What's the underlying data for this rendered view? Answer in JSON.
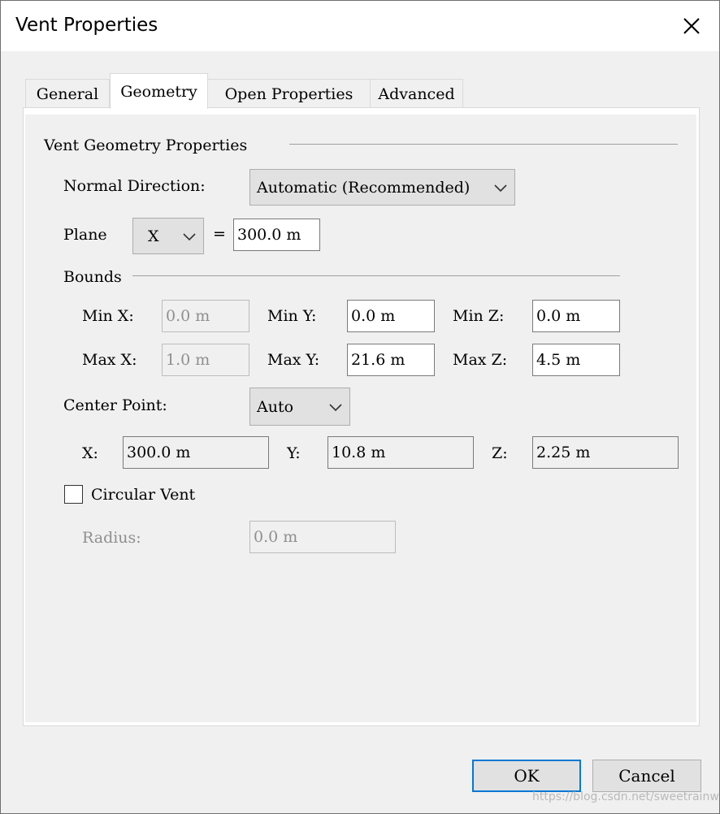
{
  "window": {
    "title": "Vent Properties",
    "close_icon": "close-icon"
  },
  "tabs": [
    {
      "label": "General",
      "active": false
    },
    {
      "label": "Geometry",
      "active": true
    },
    {
      "label": "Open Properties",
      "active": false
    },
    {
      "label": "Advanced",
      "active": false
    }
  ],
  "geometry": {
    "group_label": "Vent Geometry Properties",
    "normal_direction": {
      "label": "Normal Direction:",
      "value": "Automatic (Recommended)"
    },
    "plane": {
      "label": "Plane",
      "axis": "X",
      "equals": "=",
      "value": "300.0 m"
    },
    "bounds": {
      "label": "Bounds",
      "min_x": {
        "label": "Min X:",
        "value": "0.0 m"
      },
      "min_y": {
        "label": "Min Y:",
        "value": "0.0 m"
      },
      "min_z": {
        "label": "Min Z:",
        "value": "0.0 m"
      },
      "max_x": {
        "label": "Max X:",
        "value": "1.0 m"
      },
      "max_y": {
        "label": "Max Y:",
        "value": "21.6 m"
      },
      "max_z": {
        "label": "Max Z:",
        "value": "4.5 m"
      }
    },
    "center_point": {
      "label": "Center Point:",
      "mode": "Auto",
      "x": {
        "label": "X:",
        "value": "300.0 m"
      },
      "y": {
        "label": "Y:",
        "value": "10.8 m"
      },
      "z": {
        "label": "Z:",
        "value": "2.25 m"
      }
    },
    "circular_vent": {
      "label": "Circular Vent",
      "checked": false
    },
    "radius": {
      "label": "Radius:",
      "value": "0.0 m"
    }
  },
  "buttons": {
    "ok": "OK",
    "cancel": "Cancel"
  },
  "watermark": "https://blog.csdn.net/sweetrainw",
  "colors": {
    "accent": "#0078d7",
    "window_bg": "#f0f0f0"
  }
}
